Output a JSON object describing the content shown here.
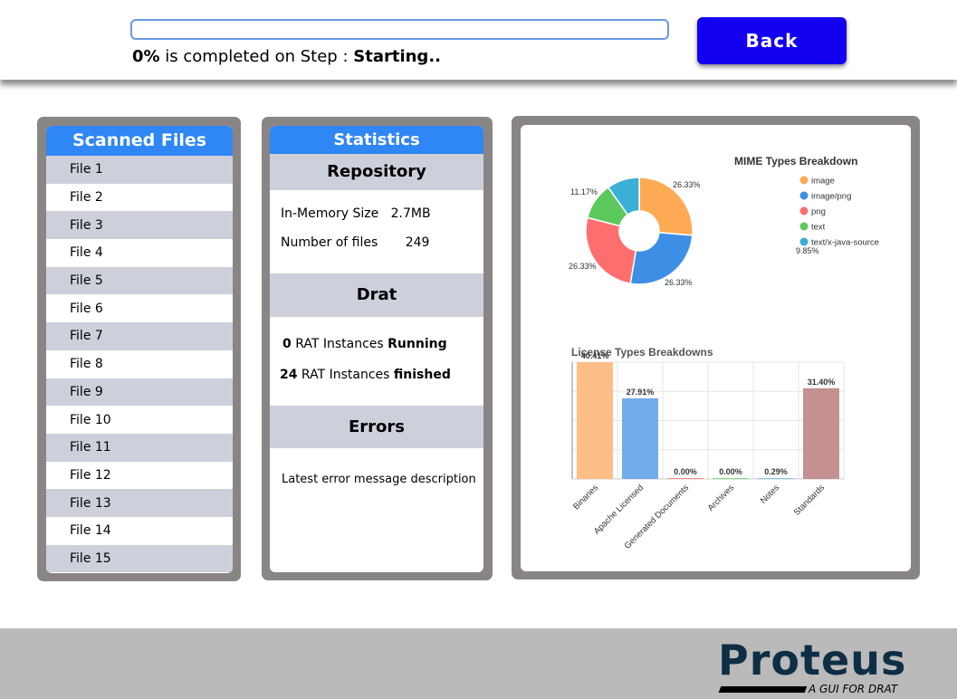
{
  "header": {
    "progress": {
      "percent": 0,
      "percent_label": "0%",
      "middle_text": " is completed on Step : ",
      "step": "Starting.."
    },
    "back_label": "Back"
  },
  "files": {
    "title": "Scanned Files",
    "items": [
      "File 1",
      "File 2",
      "File 3",
      "File 4",
      "File 5",
      "File 6",
      "File 7",
      "File 8",
      "File 9",
      "File 10",
      "File 11",
      "File 12",
      "File 13",
      "File 14",
      "File 15"
    ]
  },
  "stats": {
    "title": "Statistics",
    "repository": {
      "heading": "Repository",
      "memory_label": "In-Memory Size",
      "memory_value": "2.7MB",
      "files_label": "Number of files",
      "files_value": "249"
    },
    "drat": {
      "heading": "Drat",
      "running_count": "0",
      "running_mid": " RAT Instances ",
      "running_word": "Running",
      "finished_count": "24",
      "finished_mid": " RAT Instances ",
      "finished_word": "finished"
    },
    "errors": {
      "heading": "Errors",
      "message": "Latest error message description"
    }
  },
  "chart_data": [
    {
      "type": "pie",
      "title": "MIME Types Breakdown",
      "labels": [
        "image",
        "image/png",
        "png",
        "text",
        "text/x-java-source"
      ],
      "values": [
        26.33,
        26.33,
        26.33,
        11.17,
        9.85
      ],
      "value_labels": [
        "26.33%",
        "26.33%",
        "26.33%",
        "11.17%",
        "9.85%"
      ],
      "colors": [
        "#ffaa55",
        "#3d8fe5",
        "#ff6e6e",
        "#5bc95b",
        "#3ab0d8"
      ],
      "donut": true,
      "legend": "right"
    },
    {
      "type": "bar",
      "title": "License Types Breakdowns",
      "categories": [
        "Binaries",
        "Apache Licensed",
        "Generated Documents",
        "Archives",
        "Notes",
        "Standards"
      ],
      "values": [
        40.41,
        27.91,
        0.0,
        0.0,
        0.29,
        31.4
      ],
      "value_labels": [
        "40.41%",
        "27.91%",
        "0.00%",
        "0.00%",
        "0.29%",
        "31.40%"
      ],
      "colors": [
        "#ffbb80",
        "#6aa9e8",
        "#ff8585",
        "#7ed37e",
        "#6ec2e3",
        "#c28a8a"
      ],
      "ylim": [
        0,
        40.41
      ],
      "grid": true
    }
  ],
  "footer": {
    "brand": "Proteus",
    "tagline": "A GUI FOR DRAT"
  }
}
